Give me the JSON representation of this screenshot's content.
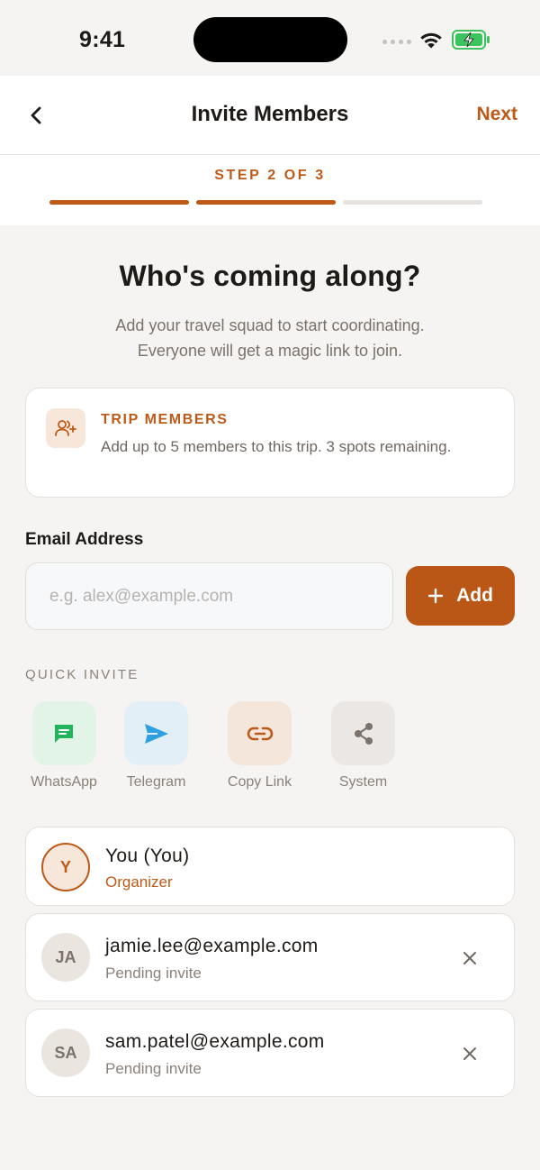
{
  "status_bar": {
    "time": "9:41"
  },
  "nav": {
    "title": "Invite Members",
    "next_label": "Next"
  },
  "stepper": {
    "label": "STEP 2 OF 3",
    "current": 2,
    "total": 3
  },
  "hero": {
    "title": "Who's coming along?",
    "subtitle_line1": "Add your travel squad to start coordinating.",
    "subtitle_line2": "Everyone will get a magic link to join."
  },
  "info_card": {
    "icon": "add-user-icon",
    "title": "TRIP MEMBERS",
    "text": "Add up to 5 members to this trip. 3 spots remaining."
  },
  "email": {
    "label": "Email Address",
    "placeholder": "e.g. alex@example.com",
    "value": "",
    "add_label": "Add"
  },
  "quick_invite": {
    "label": "QUICK INVITE",
    "items": [
      {
        "label": "WhatsApp",
        "icon": "chat-icon",
        "color": "#22b45b",
        "bg": "#e2f4e8"
      },
      {
        "label": "Telegram",
        "icon": "send-icon",
        "color": "#2e9fe0",
        "bg": "#e2eff7"
      },
      {
        "label": "Copy Link",
        "icon": "link-icon",
        "color": "#bd5a17",
        "bg": "#f5e6dc"
      },
      {
        "label": "System",
        "icon": "share-icon",
        "color": "#7a726b",
        "bg": "#ebe7e4"
      }
    ]
  },
  "members": [
    {
      "initials": "Y",
      "name": "You (You)",
      "subtitle": "Organizer"
    },
    {
      "initials": "JA",
      "name": "jamie.lee@example.com",
      "subtitle": "Pending invite"
    },
    {
      "initials": "SA",
      "name": "sam.patel@example.com",
      "subtitle": "Pending invite"
    }
  ],
  "colors": {
    "accent": "#bd5a17",
    "background": "#f6f4f2"
  }
}
